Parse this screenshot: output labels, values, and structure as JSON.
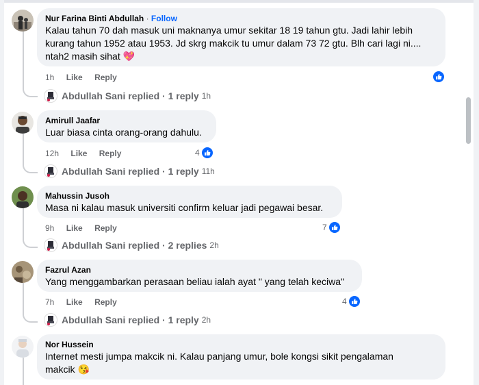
{
  "colors": {
    "accent": "#0866ff",
    "bubble": "#f0f2f5",
    "meta": "#65676b"
  },
  "comments": [
    {
      "author": "Nur Farina Binti Abdullah",
      "separator": "·",
      "follow": "Follow",
      "lines": [
        "Kalau tahun 70 dah masuk uni maknanya umur sekitar 18 19 tahun gtu. Jadi lahir lebih",
        "kurang tahun 1952 atau 1953. Jd skrg makcik tu umur dalam 73 72 gtu. Blh cari lagi ni....",
        "ntah2 masih sihat 💖"
      ],
      "time": "1h",
      "like": "Like",
      "reply": "Reply",
      "reaction_icon": "like-icon",
      "reply_summary": {
        "name": "Abdullah Sani",
        "text": "Abdullah Sani replied · 1 reply",
        "time": "1h"
      }
    },
    {
      "author": "Amirull Jaafar",
      "lines": [
        "Luar biasa cinta orang-orang dahulu."
      ],
      "time": "12h",
      "like": "Like",
      "reply": "Reply",
      "reactions": "4",
      "reaction_icon": "like-icon",
      "reply_summary": {
        "name": "Abdullah Sani",
        "text": "Abdullah Sani replied · 1 reply",
        "time": "11h"
      }
    },
    {
      "author": "Mahussin Jusoh",
      "lines": [
        "Masa ni kalau masuk universiti confirm keluar jadi pegawai besar."
      ],
      "time": "9h",
      "like": "Like",
      "reply": "Reply",
      "reactions": "7",
      "reaction_icon": "like-icon",
      "reply_summary": {
        "name": "Abdullah Sani",
        "text": "Abdullah Sani replied · 2 replies",
        "time": "2h"
      }
    },
    {
      "author": "Fazrul Azan",
      "lines": [
        "Yang menggambarkan perasaan beliau ialah ayat \" yang telah keciwa\""
      ],
      "time": "7h",
      "like": "Like",
      "reply": "Reply",
      "reactions": "4",
      "reaction_icon": "like-icon",
      "reply_summary": {
        "name": "Abdullah Sani",
        "text": "Abdullah Sani replied · 1 reply",
        "time": "2h"
      }
    },
    {
      "author": "Nor Hussein",
      "lines": [
        "Internet mesti jumpa makcik ni. Kalau panjang umur, bole kongsi sikit pengalaman",
        "makcik 😘"
      ]
    }
  ]
}
